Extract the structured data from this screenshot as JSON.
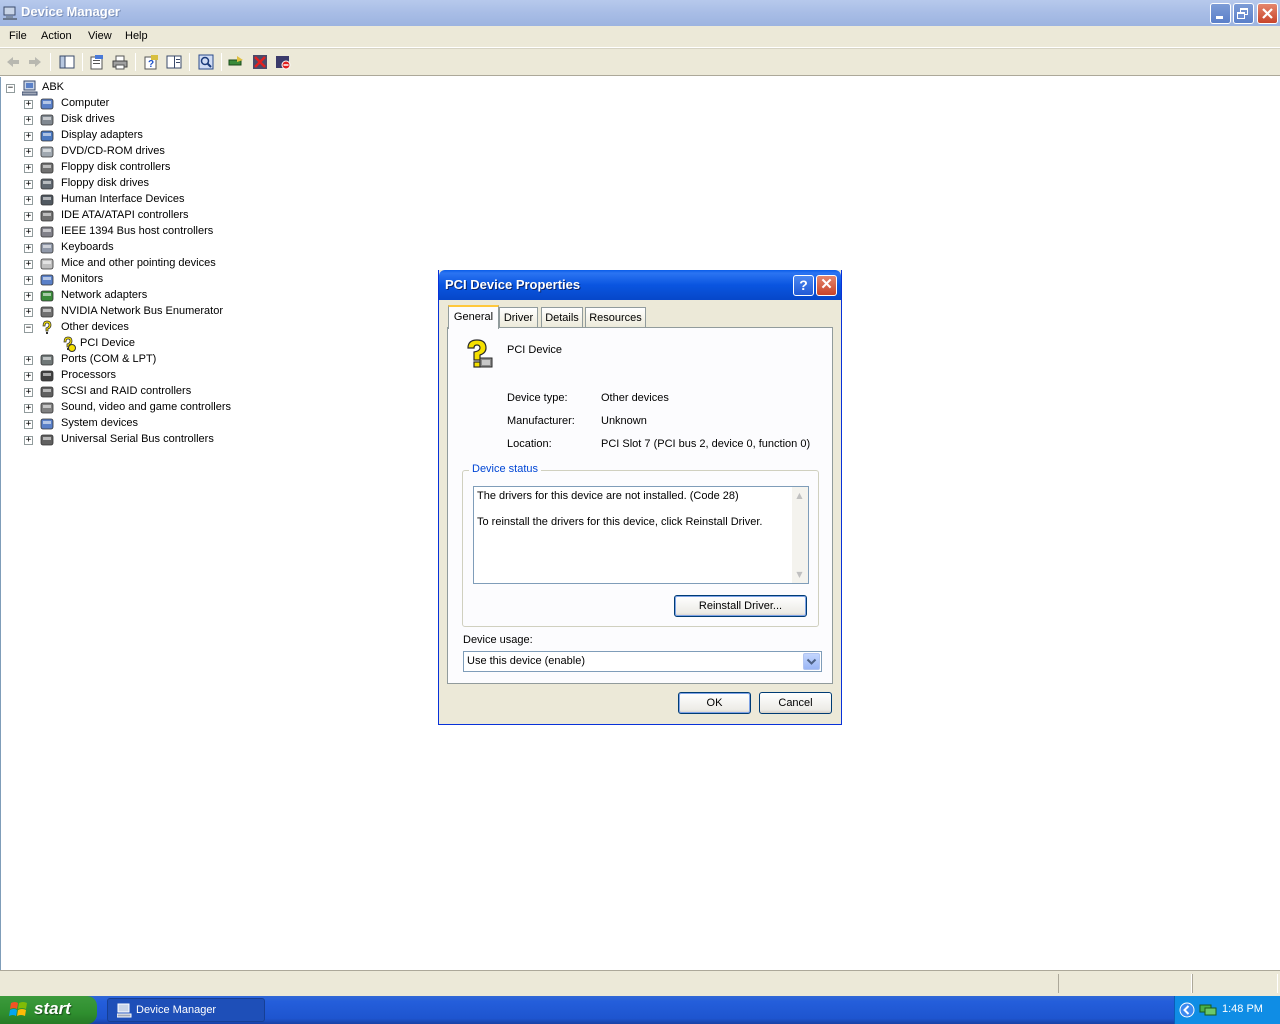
{
  "window": {
    "title": "Device Manager"
  },
  "menu": [
    "File",
    "Action",
    "View",
    "Help"
  ],
  "toolbar": {
    "icons": [
      "back-icon",
      "forward-icon",
      "show-hide-tree-icon",
      "properties-icon",
      "print-icon",
      "help-icon",
      "view-icon",
      "scan-hardware-icon",
      "update-driver-icon",
      "uninstall-icon",
      "disable-icon"
    ]
  },
  "tree": {
    "root": "ABK",
    "categories": [
      {
        "label": "Computer",
        "icon": "computer-icon",
        "expanded": false
      },
      {
        "label": "Disk drives",
        "icon": "disk-drive-icon",
        "expanded": false
      },
      {
        "label": "Display adapters",
        "icon": "display-adapter-icon",
        "expanded": false
      },
      {
        "label": "DVD/CD-ROM drives",
        "icon": "cdrom-icon",
        "expanded": false
      },
      {
        "label": "Floppy disk controllers",
        "icon": "controller-icon",
        "expanded": false
      },
      {
        "label": "Floppy disk drives",
        "icon": "floppy-icon",
        "expanded": false
      },
      {
        "label": "Human Interface Devices",
        "icon": "hid-icon",
        "expanded": false
      },
      {
        "label": "IDE ATA/ATAPI controllers",
        "icon": "ide-icon",
        "expanded": false
      },
      {
        "label": "IEEE 1394 Bus host controllers",
        "icon": "firewire-icon",
        "expanded": false
      },
      {
        "label": "Keyboards",
        "icon": "keyboard-icon",
        "expanded": false
      },
      {
        "label": "Mice and other pointing devices",
        "icon": "mouse-icon",
        "expanded": false
      },
      {
        "label": "Monitors",
        "icon": "monitor-icon",
        "expanded": false
      },
      {
        "label": "Network adapters",
        "icon": "network-adapter-icon",
        "expanded": false
      },
      {
        "label": "NVIDIA Network Bus Enumerator",
        "icon": "bus-enumerator-icon",
        "expanded": false
      },
      {
        "label": "Other devices",
        "icon": "unknown-device-icon",
        "expanded": true
      },
      {
        "label": "PCI Device",
        "icon": "unknown-device-warning-icon",
        "child": true
      },
      {
        "label": "Ports (COM & LPT)",
        "icon": "port-icon",
        "expanded": false
      },
      {
        "label": "Processors",
        "icon": "processor-icon",
        "expanded": false
      },
      {
        "label": "SCSI and RAID controllers",
        "icon": "scsi-icon",
        "expanded": false
      },
      {
        "label": "Sound, video and game controllers",
        "icon": "sound-icon",
        "expanded": false
      },
      {
        "label": "System devices",
        "icon": "system-device-icon",
        "expanded": false
      },
      {
        "label": "Universal Serial Bus controllers",
        "icon": "usb-icon",
        "expanded": false
      }
    ]
  },
  "dialog": {
    "title": "PCI Device Properties",
    "help_glyph": "?",
    "close_glyph": "✕",
    "tabs": [
      "General",
      "Driver",
      "Details",
      "Resources"
    ],
    "active_tab": "General",
    "device_name": "PCI Device",
    "props": [
      {
        "label": "Device type:",
        "value": "Other devices"
      },
      {
        "label": "Manufacturer:",
        "value": "Unknown"
      },
      {
        "label": "Location:",
        "value": "PCI Slot 7 (PCI bus 2, device 0, function 0)"
      }
    ],
    "status_group_label": "Device status",
    "status_lines": [
      "The drivers for this device are not installed. (Code 28)",
      "To reinstall the drivers for this device, click Reinstall Driver."
    ],
    "reinstall_label": "Reinstall Driver...",
    "usage_label": "Device usage:",
    "usage_value": "Use this device (enable)",
    "ok_label": "OK",
    "cancel_label": "Cancel"
  },
  "taskbar": {
    "start_label": "start",
    "task_label": "Device Manager",
    "clock": "1:48 PM"
  },
  "colors": {
    "title_active": "#0a55e0",
    "title_inactive": "#a8bde6",
    "face": "#ece9d8",
    "taskbar": "#245edb",
    "start_green": "#2f8f2f",
    "legend_blue": "#0046d5",
    "warning_yellow": "#f5e000"
  }
}
